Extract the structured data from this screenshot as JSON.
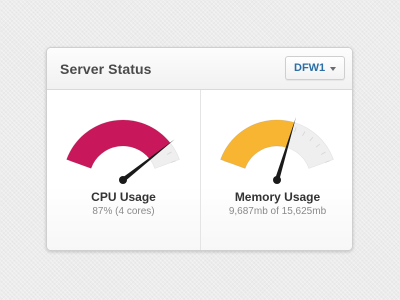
{
  "header": {
    "title": "Server Status",
    "region_select": {
      "selected": "DFW1",
      "icon": "chevron-down-icon"
    }
  },
  "gauges": [
    {
      "label": "CPU Usage",
      "detail": "87% (4 cores)",
      "fraction": 0.87,
      "color": "#c8175a"
    },
    {
      "label": "Memory Usage",
      "detail": "9,687mb of 15,625mb",
      "fraction": 0.62,
      "color": "#f7b532"
    }
  ],
  "colors": {
    "track": "#efefef",
    "needle": "#1a1a1a",
    "accent_link": "#2b6fa6"
  }
}
